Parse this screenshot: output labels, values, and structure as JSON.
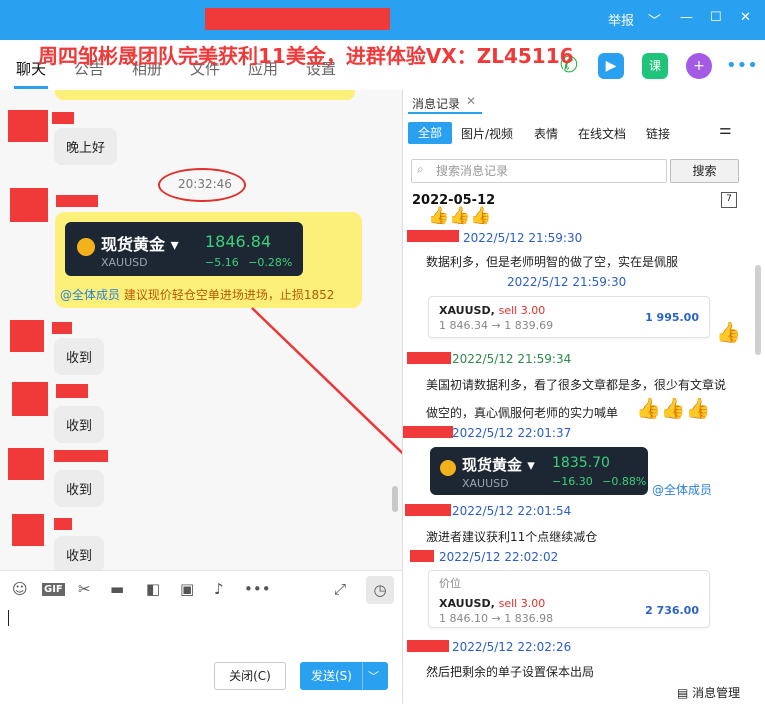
{
  "window": {
    "report_label": "举报",
    "controls": [
      "﹀",
      "—",
      "☐",
      "✕"
    ]
  },
  "banner": "周四邹彬晟团队完美获利11美金，进群体验VX：ZL45116",
  "tabs": [
    "聊天",
    "公告",
    "相册",
    "文件",
    "应用",
    "设置"
  ],
  "chat": {
    "messages": [
      {
        "text": "晚上好"
      },
      {
        "text": "收到"
      },
      {
        "text": "收到"
      },
      {
        "text": "收到"
      },
      {
        "text": "收到"
      }
    ],
    "timestamp": "20:32:46",
    "gold_card": {
      "title": "现货黄金",
      "symbol": "XAUUSD",
      "price": "1846.84",
      "change": "−5.16",
      "change_pct": "−0.28%"
    },
    "mention_all": "@全体成员",
    "mention_text": "建议现价轻仓空单进场进场，止损1852"
  },
  "input_toolbar": {
    "icons": [
      "smile-icon",
      "gif-icon",
      "scissors-icon",
      "folder-icon",
      "sticker-icon",
      "image-icon",
      "bell-icon",
      "more-icon"
    ],
    "gif_label": "GIF"
  },
  "buttons": {
    "close_label": "关闭(C)",
    "send_label": "发送(S)"
  },
  "history": {
    "title": "消息记录",
    "filters": [
      "全部",
      "图片/视频",
      "表情",
      "在线文档",
      "链接"
    ],
    "search_placeholder": "搜索消息记录",
    "search_button": "搜索",
    "date": "2022-05-12",
    "calendar_label": "7",
    "entries": [
      {
        "time": "2022/5/12 21:59:30",
        "text": "数据利多，但是老师明智的做了空，实在是佩服"
      },
      {
        "time": "2022/5/12 21:59:30"
      },
      {
        "time": "2022/5/12 21:59:34",
        "text": "美国初请数据利多，看了很多文章都是多，很少有文章说",
        "text2": "做空的，真心佩服何老师的实力喊单"
      },
      {
        "time": "2022/5/12 22:01:37"
      },
      {
        "time": "2022/5/12 22:01:54",
        "text": "激进者建议获利11个点继续减仓"
      },
      {
        "time": "2022/5/12 22:02:02"
      },
      {
        "time": "2022/5/12 22:02:26",
        "text": "然后把剩余的单子设置保本出局"
      }
    ],
    "quote1": {
      "symbol": "XAUUSD,",
      "side": "sell 3.00",
      "range": "1 846.34 → 1 839.69",
      "amount": "1 995.00"
    },
    "quote2": {
      "label": "价位",
      "symbol": "XAUUSD,",
      "side": "sell 3.00",
      "range": "1 846.10 → 1 836.98",
      "amount": "2 736.00"
    },
    "gold_card": {
      "title": "现货黄金",
      "symbol": "XAUUSD",
      "price": "1835.70",
      "change": "−16.30",
      "change_pct": "−0.88%"
    },
    "mention_all": "@全体成员",
    "manage_label": "消息管理"
  }
}
